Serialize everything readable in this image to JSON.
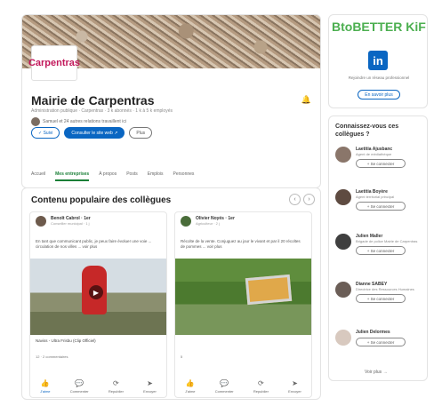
{
  "page": {
    "org_name": "Mairie de Carpentras",
    "org_meta": "Administration publique · Carpentras · 3 k abonnés · 1 k à 5 k employés",
    "connections": "Samuel et 24 autres relations travaillent ici",
    "logo_text": "Carpentras",
    "buttons": {
      "follow": "✓ Suivi",
      "website": "Consulter le site web ↗",
      "more": "Plus"
    },
    "tabs": [
      "Accueil",
      "Mes entreprises",
      "À propos",
      "Posts",
      "Emplois",
      "Personnes"
    ]
  },
  "content": {
    "title": "Contenu populaire des collègues",
    "prev": "‹",
    "next": "›",
    "posts": [
      {
        "author": "Benoît Cabrol · 1er",
        "sub": "Conseiller municipal · 1 j",
        "text": "En tant que communicant public, je peux faire évoluer une voie ... circulation de nos villes ... voir plus",
        "caption": "Naviss - Ultra Frisbu (Clip Officiel)",
        "reactions": "12 · 2 commentaires",
        "actions": [
          "J'aime",
          "Commenter",
          "Republier",
          "Envoyer"
        ]
      },
      {
        "author": "Olivier Noyés · 1er",
        "sub": "Agriculteur · 2 j",
        "text": "Récolte de la vente. Conjuguez au jour le vivant et par il 20 récoltes de pommes ... voir plus",
        "caption": "",
        "reactions": "5",
        "actions": [
          "J'aime",
          "Commenter",
          "Republier",
          "Envoyer"
        ]
      }
    ]
  },
  "sidebar": {
    "ad": {
      "banner": "BtoBETTER KiF",
      "logo": "in",
      "text": "Rejoindre un réseau professionnel",
      "button": "En savoir plus"
    },
    "people": {
      "title": "Connaissez-vous ces collègues ?",
      "items": [
        {
          "name": "Laetitia Ajusbanc",
          "role": "Agent de médiathèque",
          "button": "+ Se connecter"
        },
        {
          "name": "Laetitia Boyère",
          "role": "Agent territorial principal",
          "button": "+ Se connecter"
        },
        {
          "name": "Julien Maller",
          "role": "Brigade de police Mairie de Carpentras",
          "button": "+ Se connecter"
        },
        {
          "name": "Dianne SABEY",
          "role": "Directrice des Ressources Humaines",
          "button": "+ Se connecter"
        },
        {
          "name": "Julien Delormes",
          "role": "",
          "button": "+ Se connecter"
        }
      ],
      "see_all": "Voir plus →"
    }
  }
}
